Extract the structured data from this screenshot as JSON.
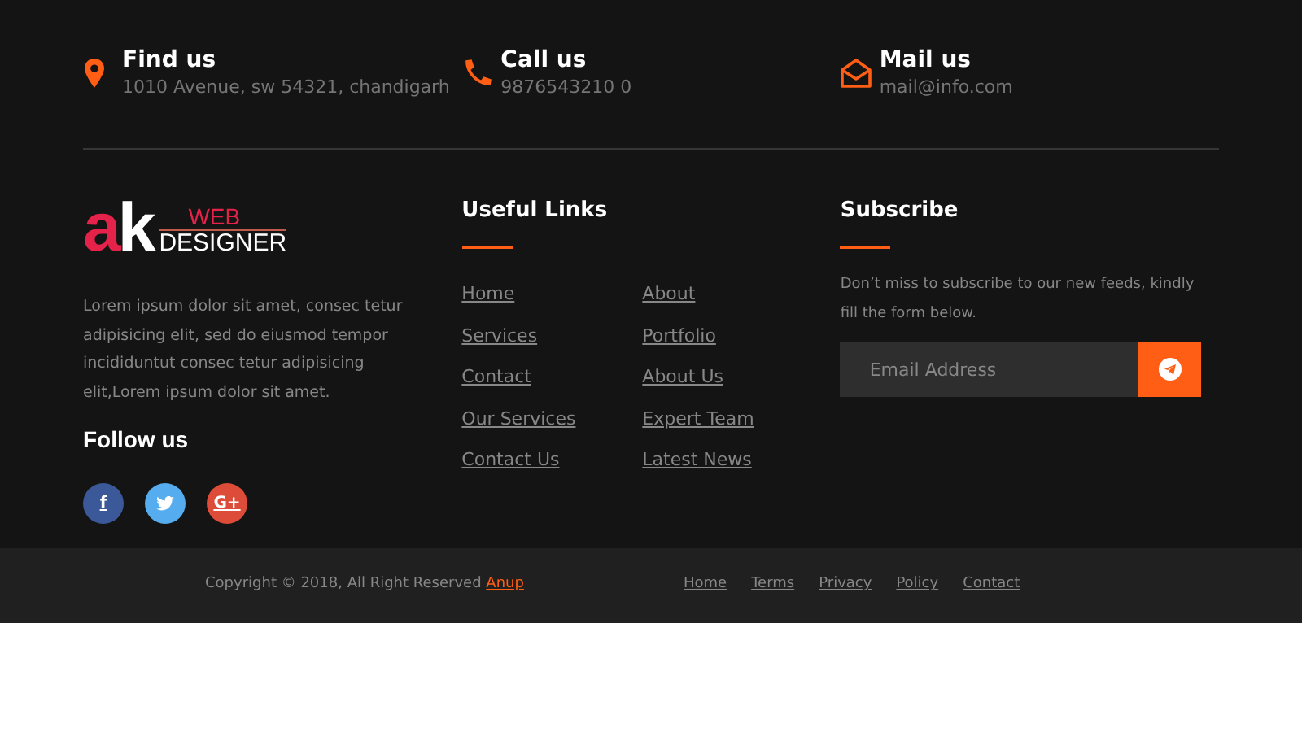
{
  "contacts": [
    {
      "kind": "pin",
      "title": "Find us",
      "text": "1010 Avenue, sw 54321, chandigarh"
    },
    {
      "kind": "phone",
      "title": "Call us",
      "text": "9876543210 0"
    },
    {
      "kind": "mail",
      "title": "Mail us",
      "text": "mail@info.com"
    }
  ],
  "logo": {
    "mark": "ak",
    "top": "WEB",
    "bottom": "DESIGNER"
  },
  "about": "Lorem ipsum dolor sit amet, consec tetur adipisicing elit, sed do eiusmod tempor incididuntut consec tetur adipisicing elit,Lorem ipsum dolor sit amet.",
  "follow_title": "Follow us",
  "socials": [
    {
      "kind": "text",
      "label": "f",
      "color": "#3b5998"
    },
    {
      "kind": "bird",
      "color": "#55acee"
    },
    {
      "kind": "text",
      "label": "G+",
      "color": "#dd4b39"
    }
  ],
  "useful_links": {
    "title": "Useful Links",
    "links": [
      "Home",
      "About",
      "Services",
      "Portfolio",
      "Contact",
      "About Us",
      "Our Services",
      "Expert Team",
      "Contact Us",
      "Latest News"
    ]
  },
  "subscribe": {
    "title": "Subscribe",
    "text": "Don’t miss to subscribe to our new feeds, kindly fill the form below.",
    "placeholder": "Email Address"
  },
  "copyright": {
    "text": "Copyright © 2018, All Right Reserved ",
    "link": "Anup"
  },
  "bottom_links": [
    "Home",
    "Terms",
    "Privacy",
    "Policy",
    "Contact"
  ]
}
